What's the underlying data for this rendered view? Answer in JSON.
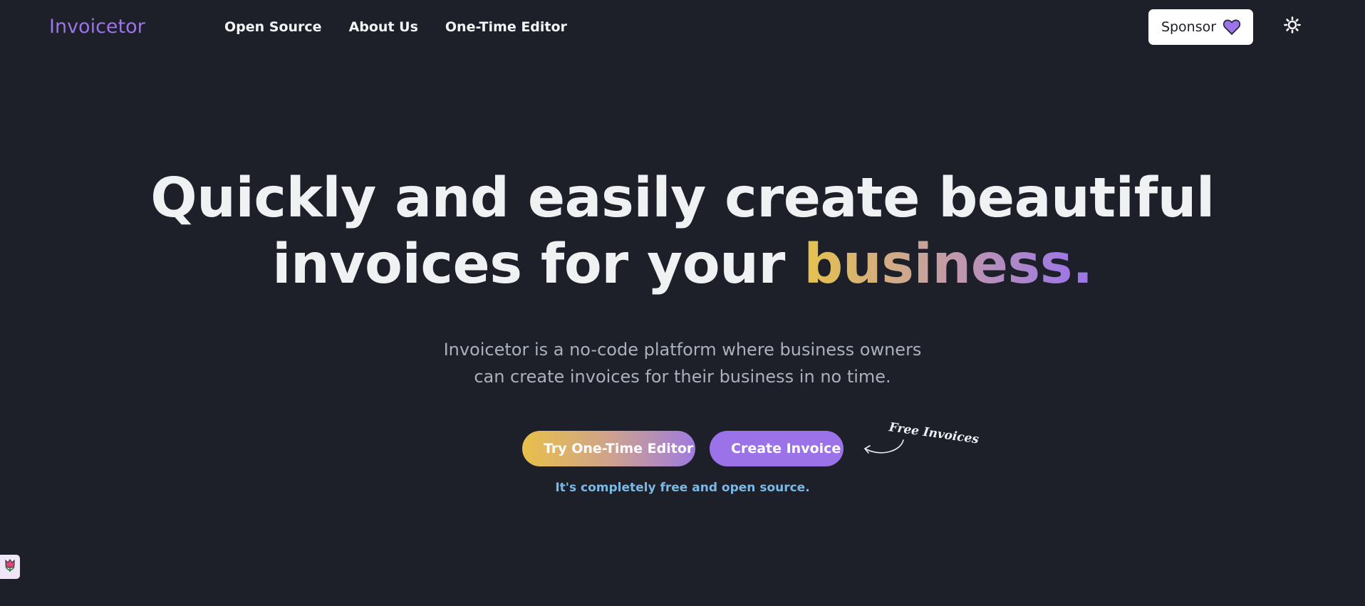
{
  "colors": {
    "background": "#1d2029",
    "brand_purple": "#9c73e8",
    "gradient_yellow": "#e7c24d",
    "subtitle_gray": "#aab0bd",
    "note_blue": "#7ab9e6"
  },
  "header": {
    "logo": "Invoicetor",
    "nav": [
      {
        "label": "Open Source"
      },
      {
        "label": "About Us"
      },
      {
        "label": "One-Time Editor"
      }
    ],
    "sponsor_label": "Sponsor",
    "sponsor_icon": "heart-icon",
    "theme_icon": "sun-icon"
  },
  "hero": {
    "title_line1": "Quickly and easily create beautiful",
    "title_line2_prefix": "invoices for your ",
    "title_highlight": "business",
    "title_dot": ".",
    "subtitle_line1": "Invoicetor is a no-code platform where business owners",
    "subtitle_line2": "can create invoices for their business in no time."
  },
  "cta": {
    "editor_label": "Try One-Time Editor",
    "create_label": "Create Invoice",
    "annotation": "Free Invoices",
    "annotation_icon": "curved-arrow-icon",
    "note": "It's completely free and open source."
  },
  "corner_badge": {
    "icon": "tulip-icon"
  }
}
